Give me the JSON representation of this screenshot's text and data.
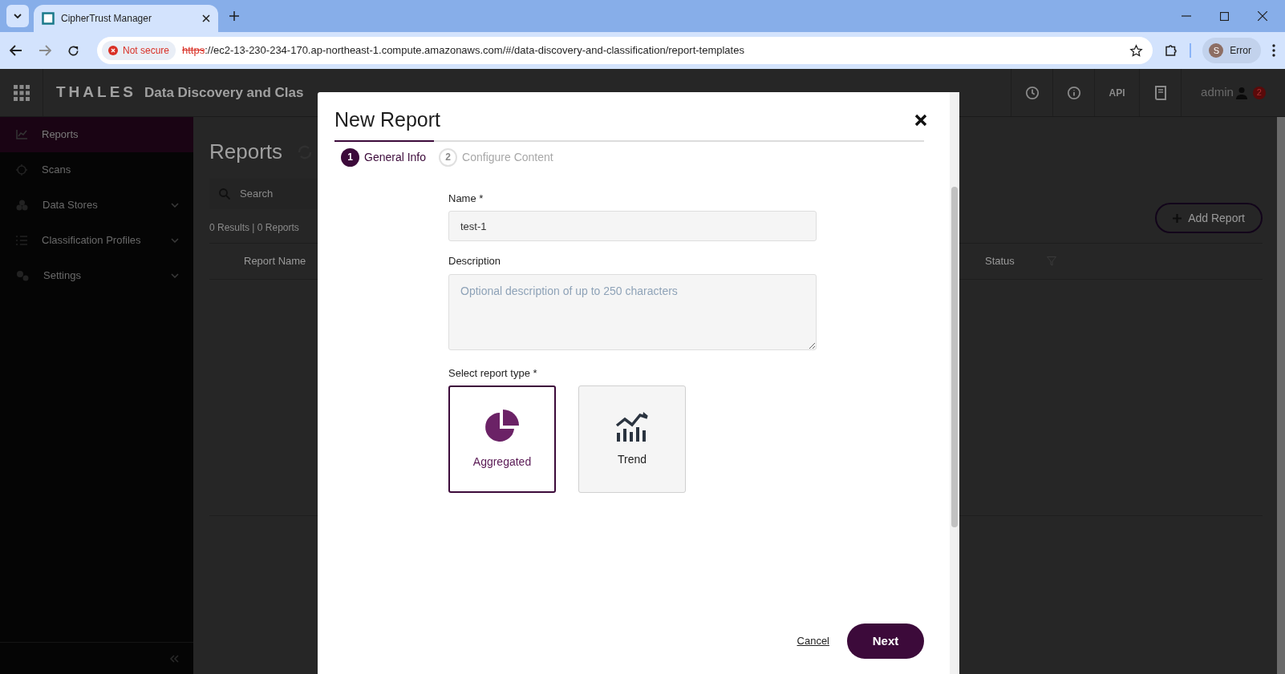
{
  "browser": {
    "tab_title": "CipherTrust Manager",
    "security": "Not secure",
    "url_scheme": "https",
    "url_rest": "://ec2-13-230-234-170.ap-northeast-1.compute.amazonaws.com/#/data-discovery-and-classification/report-templates",
    "profile_initial": "S",
    "profile_label": "Error"
  },
  "app": {
    "brand": "THALES",
    "title": "Data Discovery and Clas",
    "header_api": "API",
    "user": "admin",
    "notification_count": "2"
  },
  "sidebar": {
    "items": [
      {
        "label": "Reports",
        "selected": true,
        "expandable": false
      },
      {
        "label": "Scans",
        "selected": false,
        "expandable": false
      },
      {
        "label": "Data Stores",
        "selected": false,
        "expandable": true
      },
      {
        "label": "Classification Profiles",
        "selected": false,
        "expandable": true
      },
      {
        "label": "Settings",
        "selected": false,
        "expandable": true
      }
    ]
  },
  "page": {
    "title": "Reports",
    "search": {
      "placeholder": "Search"
    },
    "results": "0 Results | 0 Reports",
    "add_button": "Add Report",
    "columns": [
      {
        "label": "Report Name"
      },
      {
        "label": "Status",
        "filter": true
      }
    ]
  },
  "modal": {
    "title": "New Report",
    "steps": [
      {
        "number": "1",
        "label": "General Info",
        "selected": true
      },
      {
        "number": "2",
        "label": "Configure Content",
        "selected": false
      }
    ],
    "name_label": "Name *",
    "name_value": "test-1",
    "description_label": "Description",
    "description": {
      "placeholder": "Optional description of up to 250 characters"
    },
    "type_label": "Select report type *",
    "report_types": [
      {
        "label": "Aggregated",
        "kind": "pie",
        "selected": true
      },
      {
        "label": "Trend",
        "kind": "trend",
        "selected": false
      }
    ],
    "cancel": "Cancel",
    "next": "Next"
  }
}
